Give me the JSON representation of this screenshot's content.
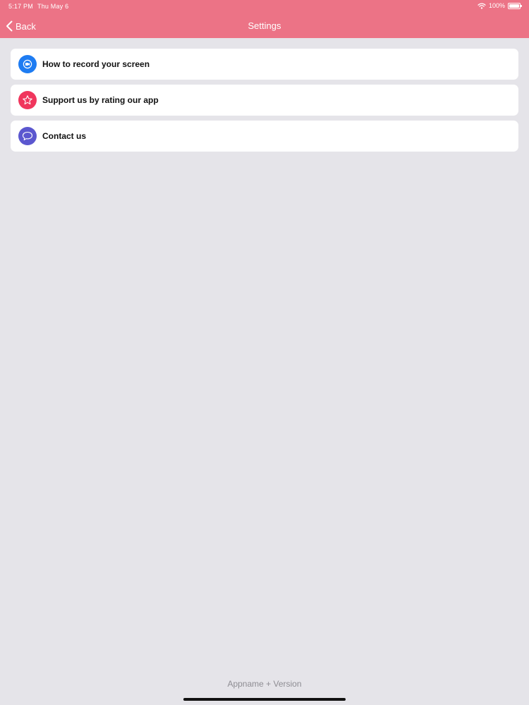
{
  "status_bar": {
    "time": "5:17 PM",
    "date": "Thu May 6",
    "battery": "100%"
  },
  "nav": {
    "back_label": "Back",
    "title": "Settings",
    "bar_color": "#ec7386"
  },
  "menu": {
    "items": [
      {
        "label": "How to record your screen",
        "icon": "screen-record-icon",
        "color": "#1e7cf2"
      },
      {
        "label": "Support us by rating our app",
        "icon": "star-icon",
        "color": "#f0365d"
      },
      {
        "label": "Contact us",
        "icon": "chat-bubble-icon",
        "color": "#5b57cf"
      }
    ]
  },
  "footer": {
    "version_text": "Appname + Version"
  }
}
